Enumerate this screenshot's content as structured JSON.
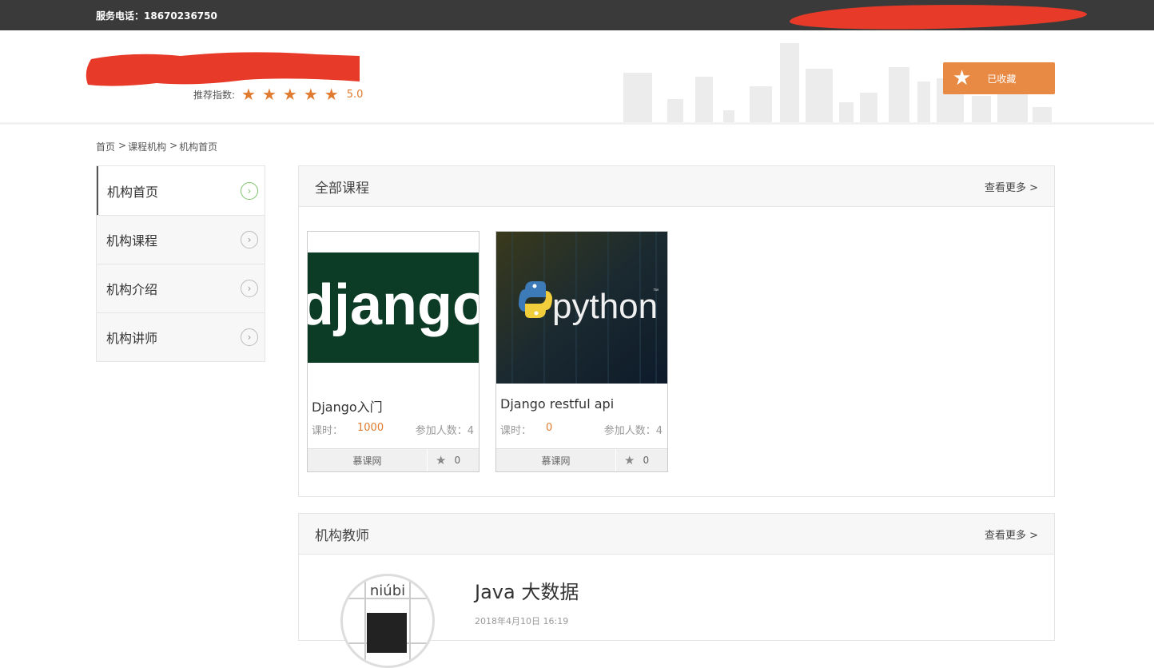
{
  "topbar": {
    "phone": "服务电话：18670236750"
  },
  "header": {
    "rating_label": "推荐指数:",
    "stars": [
      "★",
      "★",
      "★",
      "★",
      "★"
    ],
    "score": "5.0",
    "fav_label": "已收藏"
  },
  "breadcrumb": [
    "首页",
    "课程机构",
    "机构首页"
  ],
  "sidebar": {
    "items": [
      {
        "label": "机构首页"
      },
      {
        "label": "机构课程"
      },
      {
        "label": "机构介绍"
      },
      {
        "label": "机构讲师"
      }
    ]
  },
  "courses_panel": {
    "title": "全部课程",
    "more": "查看更多 >",
    "courses": [
      {
        "name": "Django入门",
        "hours_label": "课时：",
        "hours": "1000",
        "people": "参加人数：4",
        "org": "慕课网",
        "fav_count": "0",
        "thumb_text": "django"
      },
      {
        "name": "Django restful api",
        "hours_label": "课时：",
        "hours": "0",
        "people": "参加人数：4",
        "org": "慕课网",
        "fav_count": "0",
        "thumb_text": "python",
        "thumb_tm": "™"
      }
    ]
  },
  "teachers_panel": {
    "title": "机构教师",
    "more": "查看更多 >",
    "teacher": {
      "name": "Java 大数据",
      "date": "2018年4月10日 16:19",
      "avatar_text": "niúbi"
    }
  },
  "colors": {
    "accent": "#e07a2e",
    "topbar": "#3a3a3a",
    "fav_button": "#e88a44"
  }
}
